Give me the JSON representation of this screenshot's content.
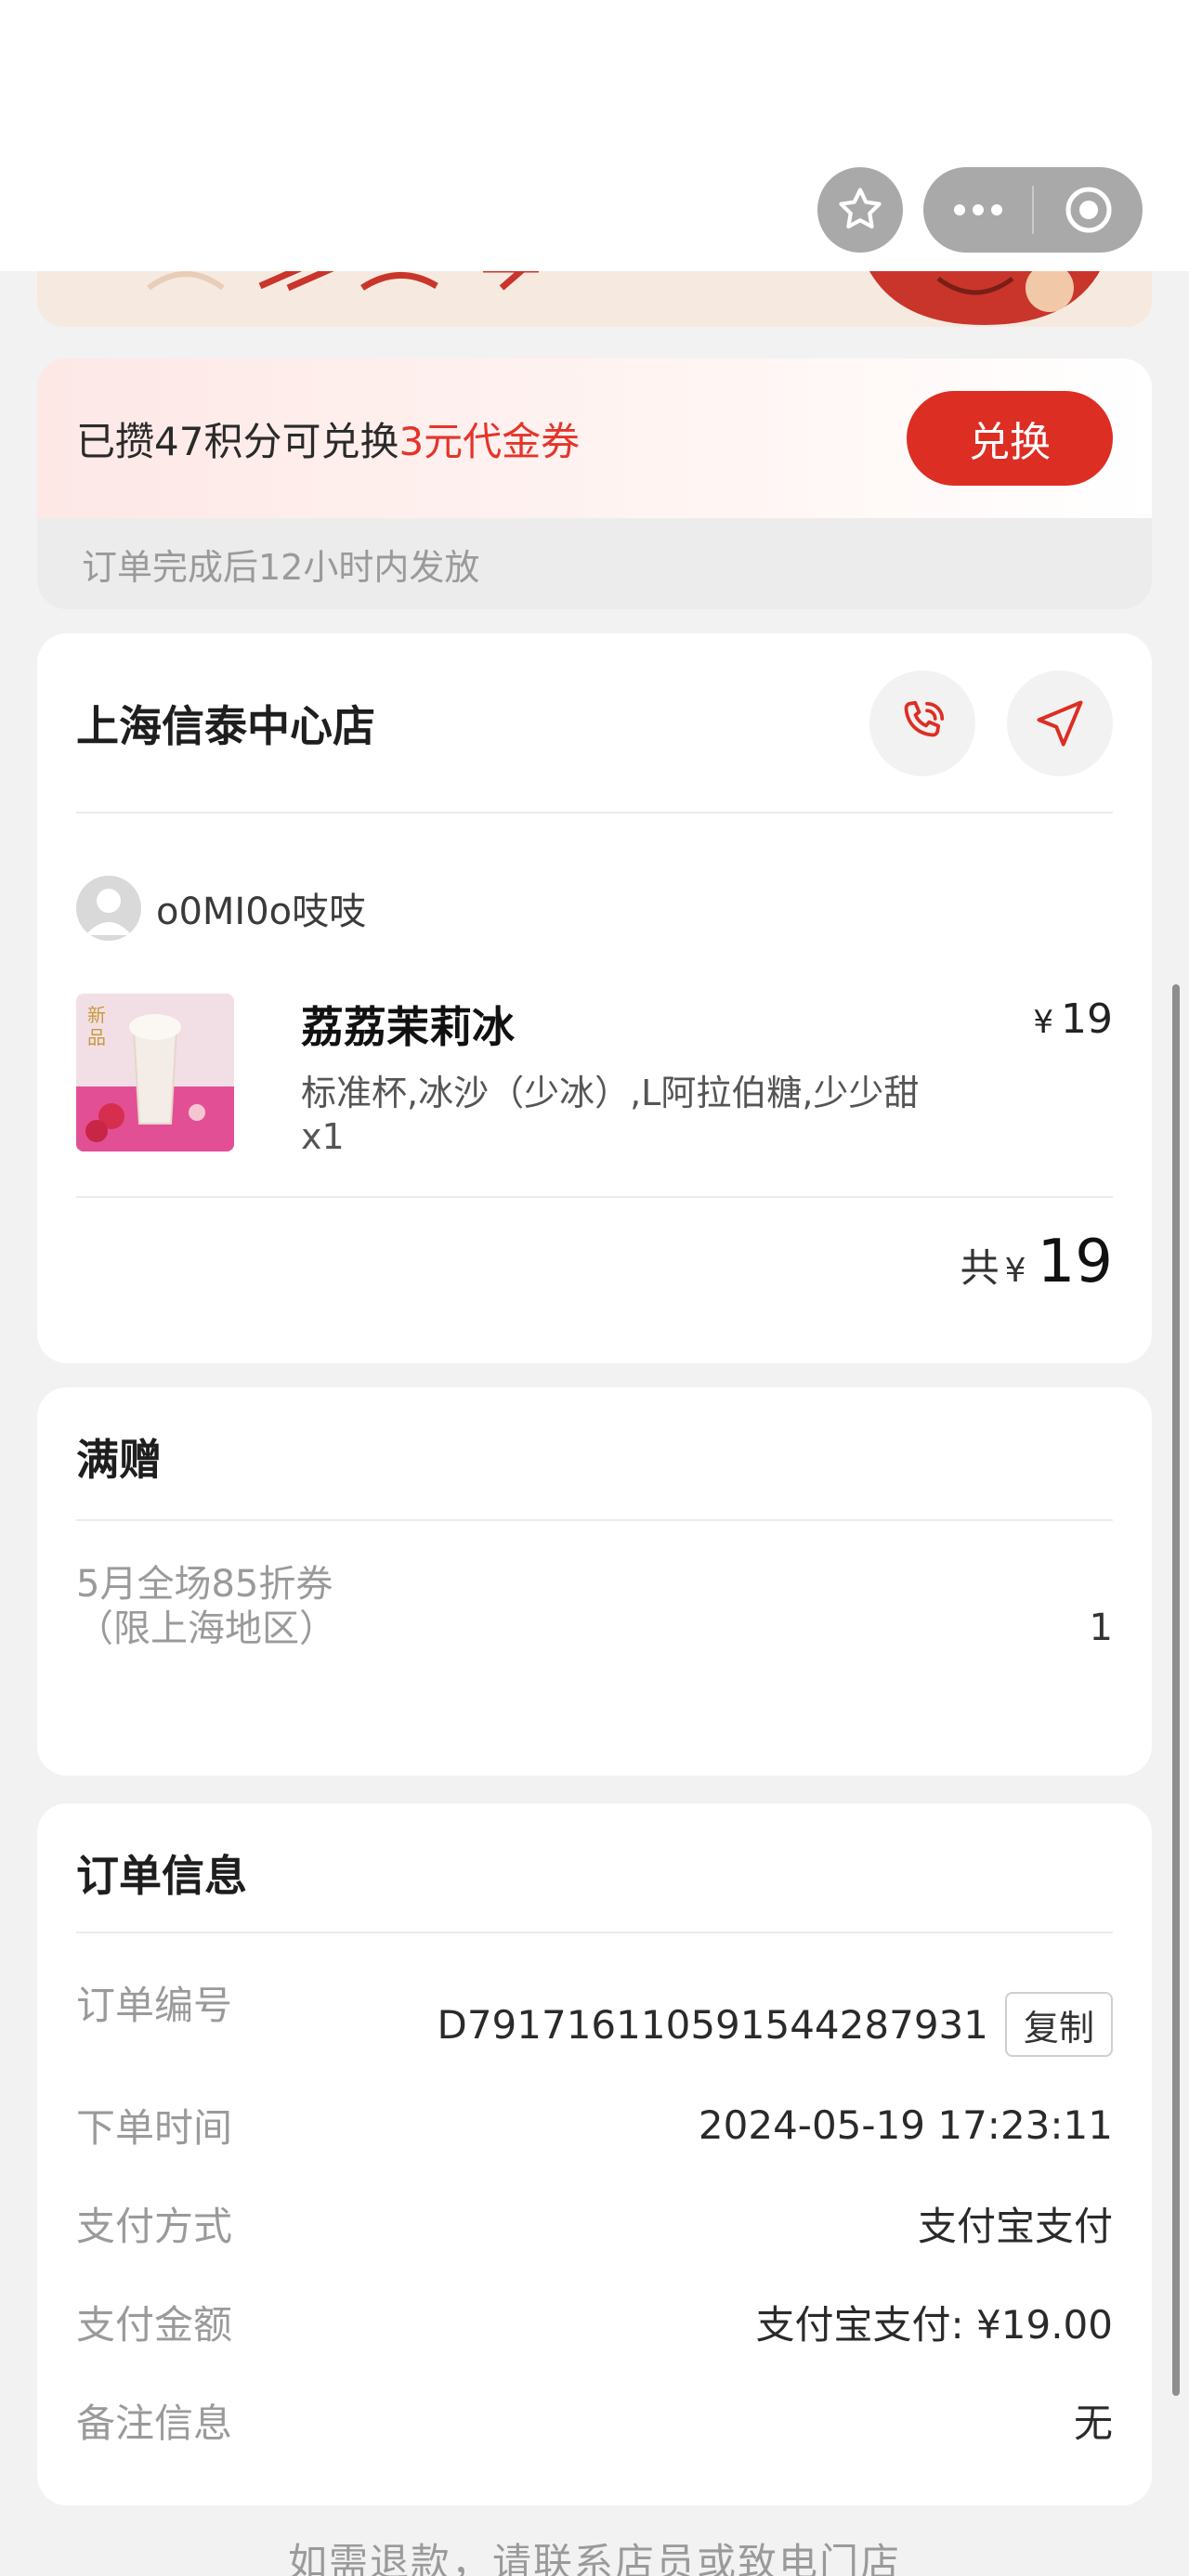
{
  "points": {
    "prefix": "已攒47积分可兑换",
    "highlight": "3元代金券",
    "redeem_label": "兑换",
    "note": "订单完成后12小时内发放"
  },
  "store": {
    "name": "上海信泰中心店",
    "user_name": "o0MI0o吱吱",
    "product": {
      "name": "荔荔茉莉冰",
      "spec": "标准杯,冰沙（少冰）,L阿拉伯糖,少少甜",
      "qty": "x1",
      "currency": "¥",
      "price": "19"
    },
    "total": {
      "prefix": "共",
      "currency": "¥",
      "amount": "19"
    }
  },
  "gift": {
    "title": "满赠",
    "name": "5月全场85折券（限上海地区）",
    "qty": "1"
  },
  "order_info": {
    "title": "订单信息",
    "rows": [
      {
        "label": "订单编号",
        "value": "D791716110591544287931"
      },
      {
        "label": "下单时间",
        "value": "2024-05-19 17:23:11"
      },
      {
        "label": "支付方式",
        "value": "支付宝支付"
      },
      {
        "label": "支付金额",
        "value": "支付宝支付: ¥19.00"
      },
      {
        "label": "备注信息",
        "value": "无"
      }
    ],
    "copy_label": "复制"
  },
  "footer_note": "如需退款，请联系店员或致电门店",
  "colors": {
    "accent": "#dd2e24",
    "highlight_text": "#e5342a",
    "muted_text": "#9a9a9a"
  }
}
